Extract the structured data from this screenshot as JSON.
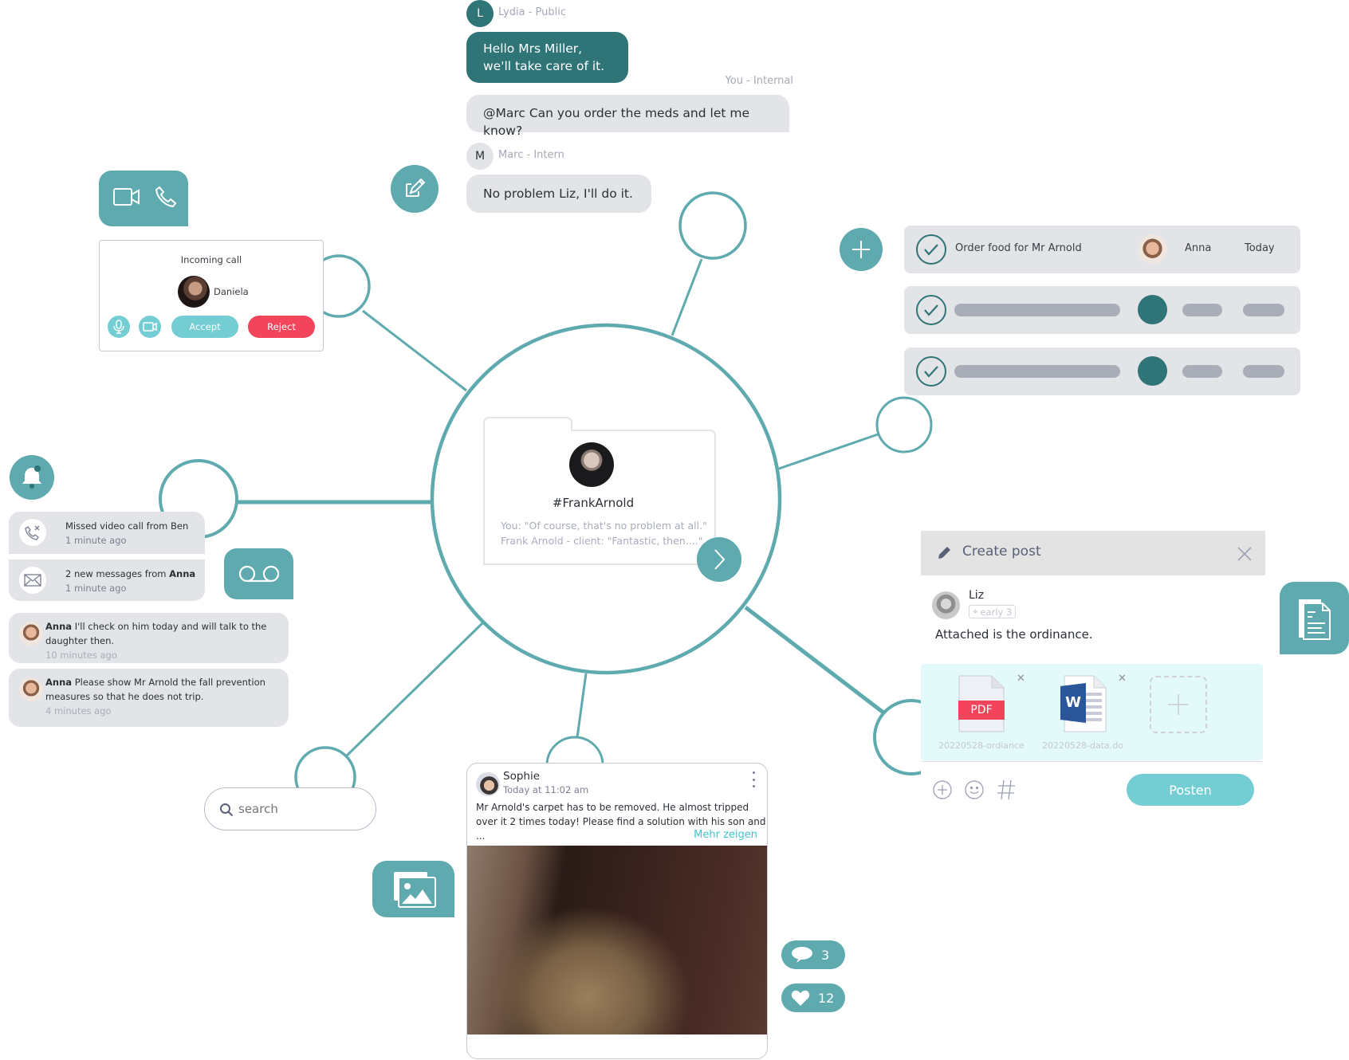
{
  "colors": {
    "teal": "#5eaaae",
    "dark_teal": "#2f7477",
    "light_teal_button": "#73cdd2",
    "reject_red": "#f2455c",
    "bubble_gray": "#e3e4e7"
  },
  "chat": {
    "messages": [
      {
        "avatar_letter": "L",
        "meta": "Lydia - Public",
        "text_line1": "Hello Mrs Miller,",
        "text_line2": "we'll take care of it."
      },
      {
        "meta": "You - Internal",
        "text": "@Marc Can you order the meds and let me know?"
      },
      {
        "avatar_letter": "M",
        "meta": "Marc - Intern",
        "text": "No problem Liz, I'll do it."
      }
    ]
  },
  "icons": {
    "call_buttons": [
      "video-camera-icon",
      "phone-icon"
    ],
    "edit": "edit-icon",
    "add_task": "plus-icon",
    "bell": "bell-icon",
    "voicemail": "voicemail-icon",
    "gallery": "image-gallery-icon",
    "document": "document-icon"
  },
  "incoming_call": {
    "title": "Incoming call",
    "caller": "Daniela",
    "accept_label": "Accept",
    "reject_label": "Reject"
  },
  "notifications": [
    {
      "icon": "missed-call-icon",
      "text": "Missed video call from Ben",
      "time": "1 minute ago"
    },
    {
      "icon": "envelope-icon",
      "text_prefix": "2 new messages from ",
      "text_bold": "Anna",
      "time": "1 minute ago"
    }
  ],
  "comments": [
    {
      "author": "Anna",
      "text": " I'll check on him today and will talk to the daughter then.",
      "time": "10 minutes ago"
    },
    {
      "author": "Anna",
      "text": " Please show Mr Arnold the fall prevention measures so that he does not trip.",
      "time": "4 minutes ago"
    }
  ],
  "client_card": {
    "name": "#FrankArnold",
    "line1": "You: \"Of course, that's no problem at all.\"",
    "line2": "Frank Arnold - client: \"Fantastic, then....\""
  },
  "tasks": [
    {
      "label": "Order food for Mr Arnold",
      "assignee": "Anna",
      "due": "Today",
      "done": true
    },
    {
      "placeholder": true,
      "done": true
    },
    {
      "placeholder": true,
      "done": true
    }
  ],
  "search": {
    "placeholder": "search"
  },
  "create_post": {
    "title": "Create post",
    "author": "Liz",
    "tag": "early 3",
    "text": "Attached is the ordinance.",
    "attachments": [
      {
        "type": "PDF",
        "name": "20220528-ordiance"
      },
      {
        "type": "W",
        "name": "20220528-data.do"
      }
    ],
    "toolbar_icons": [
      "add-circle-icon",
      "emoji-icon",
      "hashtag-icon"
    ],
    "submit_label": "Posten"
  },
  "feed_post": {
    "author": "Sophie",
    "time": "Today at 11:02 am",
    "text_line1": "Mr Arnold's carpet has to be removed. He almost tripped",
    "text_line2": "over it 2 times today! Please find a solution with his son and",
    "text_line3": "...",
    "more_label": "Mehr zeigen",
    "comments_count": "3",
    "likes_count": "12"
  }
}
